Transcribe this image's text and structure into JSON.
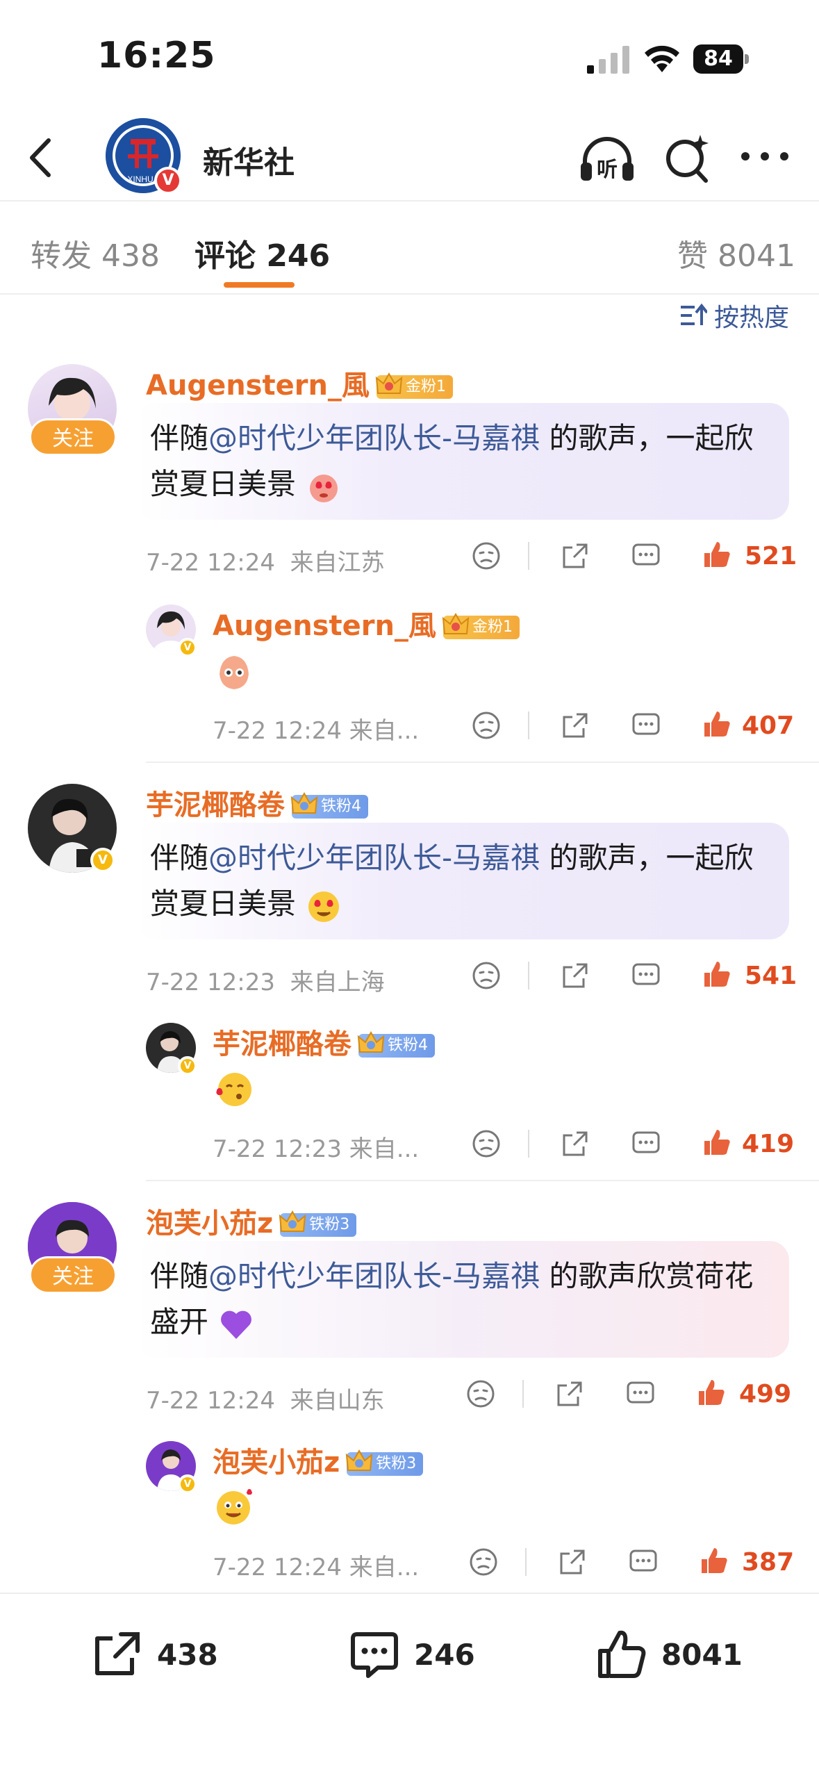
{
  "status_bar": {
    "time": "16:25",
    "battery": "84"
  },
  "nav": {
    "account_name": "新华社",
    "listen_label": "听"
  },
  "tabs": {
    "repost": "转发 438",
    "comments": "评论 246",
    "likes": "赞 8041"
  },
  "sort_label": "按热度",
  "comments": [
    {
      "name": "Augenstern_風",
      "badge": "金粉1",
      "follow_label": "关注",
      "text_prefix": "伴随",
      "mention": "@时代少年团队长-马嘉祺",
      "text_suffix": " 的歌声，一起欣赏夏日美景",
      "time": "7-22 12:24",
      "location": "来自江苏",
      "likes": "521",
      "reply": {
        "name": "Augenstern_風",
        "badge": "金粉1",
        "meta": "7-22 12:24  来自...",
        "likes": "407"
      }
    },
    {
      "name": "芋泥椰酪卷",
      "badge": "铁粉4",
      "text_prefix": "伴随",
      "mention": "@时代少年团队长-马嘉祺",
      "text_suffix": " 的歌声，一起欣赏夏日美景",
      "time": "7-22 12:23",
      "location": "来自上海",
      "likes": "541",
      "reply": {
        "name": "芋泥椰酪卷",
        "badge": "铁粉4",
        "meta": "7-22 12:23  来自...",
        "likes": "419"
      }
    },
    {
      "name": "泡芙小茄z",
      "badge": "铁粉3",
      "follow_label": "关注",
      "text_prefix": "伴随",
      "mention": "@时代少年团队长-马嘉祺",
      "text_suffix": " 的歌声欣赏荷花盛开",
      "time": "7-22 12:24",
      "location": "来自山东",
      "likes": "499",
      "reply": {
        "name": "泡芙小茄z",
        "badge": "铁粉3",
        "meta": "7-22 12:24  来自...",
        "likes": "387"
      }
    }
  ],
  "bottom_bar": {
    "repost_count": "438",
    "comment_count": "246",
    "like_count": "8041"
  },
  "colors": {
    "accent": "#f07a24",
    "mention": "#3d5a98",
    "name": "#e86c25",
    "like": "#e04b1f"
  }
}
